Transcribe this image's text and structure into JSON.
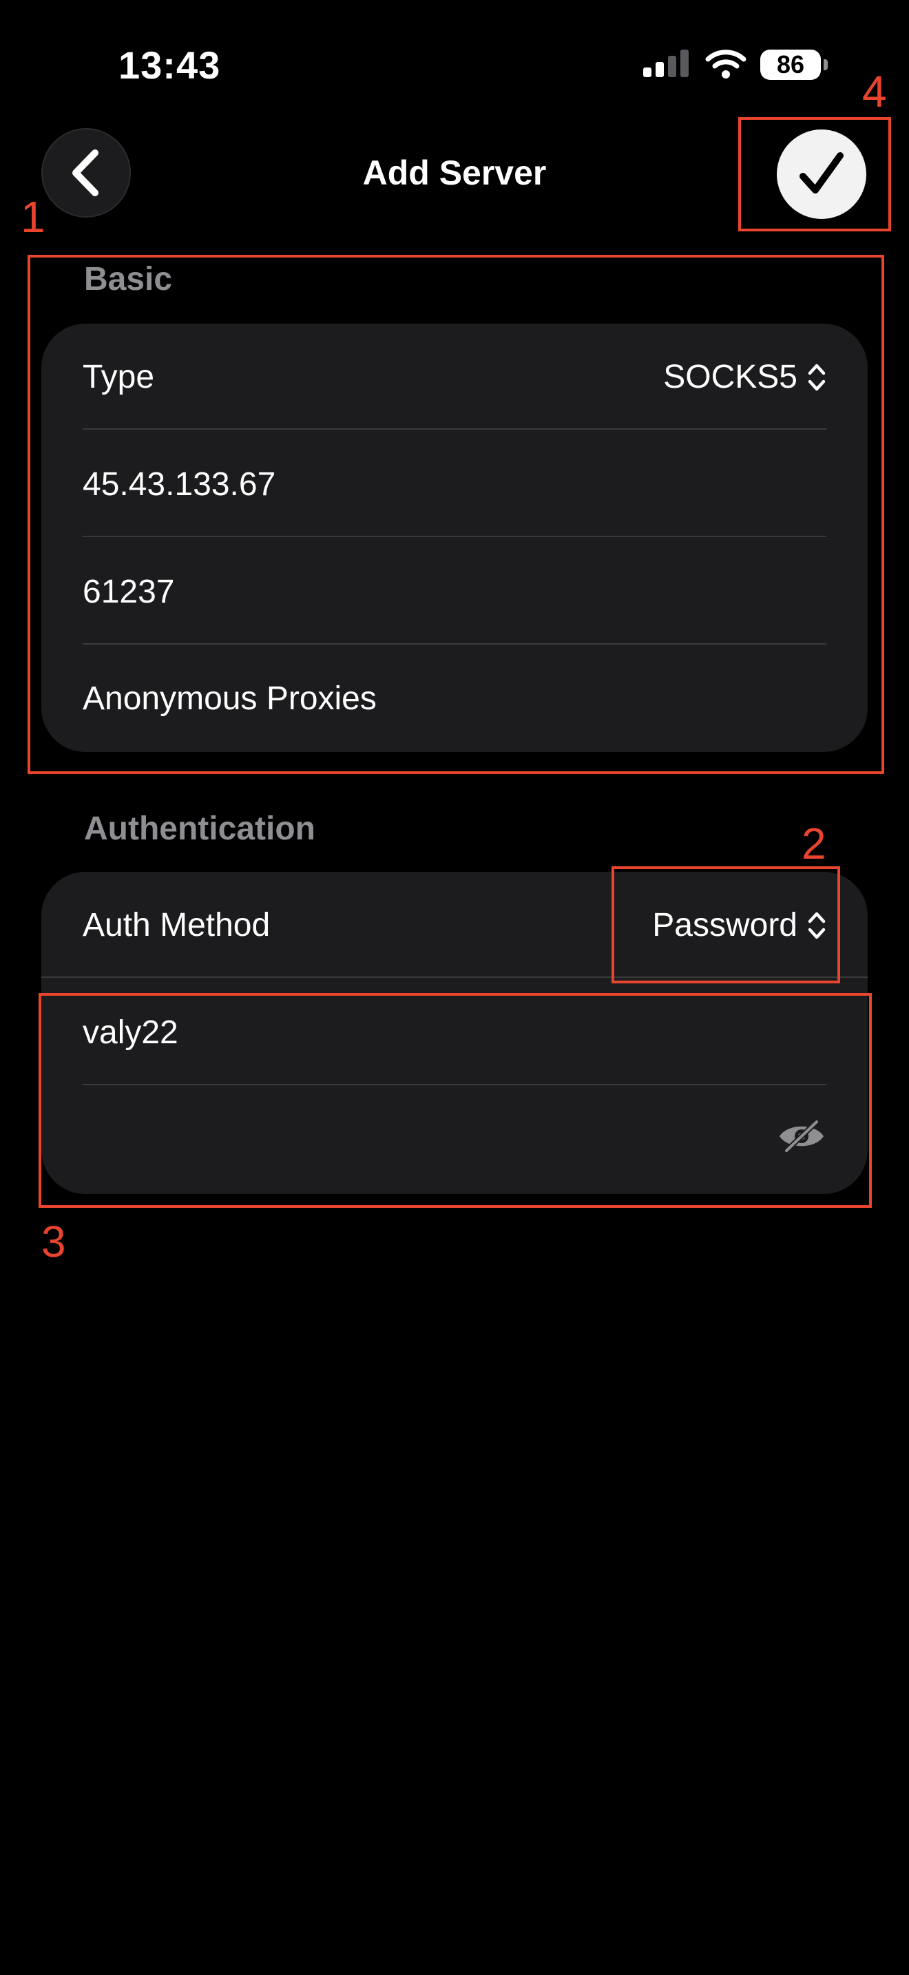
{
  "status_bar": {
    "time": "13:43",
    "battery": "86",
    "icons": [
      "cellular-signal-icon",
      "wifi-icon",
      "battery-icon"
    ]
  },
  "nav": {
    "title": "Add Server",
    "back_icon": "chevron-left-icon",
    "confirm_icon": "checkmark-icon"
  },
  "basic": {
    "header": "Basic",
    "type_label": "Type",
    "type_value": "SOCKS5",
    "host": "45.43.133.67",
    "port": "61237",
    "name": "Anonymous Proxies"
  },
  "authentication": {
    "header": "Authentication",
    "method_label": "Auth Method",
    "method_value": "Password",
    "username": "valy22",
    "password": "",
    "visibility_icon": "eye-slash-icon"
  },
  "annotations": [
    "1",
    "2",
    "3",
    "4"
  ],
  "colors": {
    "background": "#000000",
    "card": "#1c1c1e",
    "secondary_text": "#8e8e93",
    "annotation": "#e8442e"
  }
}
